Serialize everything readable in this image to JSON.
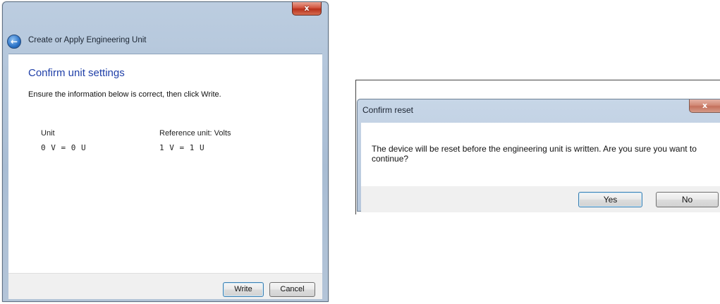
{
  "wizard": {
    "title": "Create or Apply Engineering Unit",
    "close_glyph": "x",
    "back_glyph": "←",
    "heading": "Confirm unit settings",
    "instruction": "Ensure the information below is correct, then click Write.",
    "unit_label": "Unit",
    "unit_value": "0 V = 0 U",
    "reference_label": "Reference unit: Volts",
    "reference_value": "1 V = 1 U",
    "write_label": "Write",
    "cancel_label": "Cancel"
  },
  "confirm_dialog": {
    "title": "Confirm reset",
    "close_glyph": "x",
    "message": "The device will be reset before the engineering unit is written. Are you sure you want to continue?",
    "yes_label": "Yes",
    "no_label": "No"
  },
  "colors": {
    "heading_blue": "#1f3fa8",
    "close_red": "#c8412a"
  }
}
